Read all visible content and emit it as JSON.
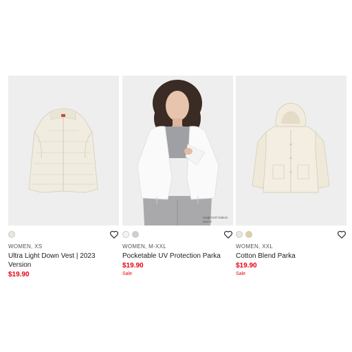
{
  "products": [
    {
      "swatches": [
        "#ebe7dc"
      ],
      "meta": "WOMEN, XS",
      "name": "Ultra Light Down Vest | 2023 Version",
      "price": "$19.90",
      "sale": ""
    },
    {
      "swatches": [
        "#f4f4f4",
        "#cfcfcf"
      ],
      "meta": "WOMEN, M-XXL",
      "name": "Pocketable UV Protection Parka",
      "price": "$19.90",
      "sale": "Sale",
      "caption_line1": "Height:5'6\"/168cm",
      "caption_line2": "Size:S"
    },
    {
      "swatches": [
        "#ebe7dc",
        "#e4cf9a"
      ],
      "meta": "WOMEN, XXL",
      "name": "Cotton Blend Parka",
      "price": "$19.90",
      "sale": "Sale"
    }
  ],
  "colors": {
    "sale_red": "#e60012",
    "image_bg": "#eeeeee"
  },
  "icons": {
    "favorite": "heart-outline-icon"
  }
}
